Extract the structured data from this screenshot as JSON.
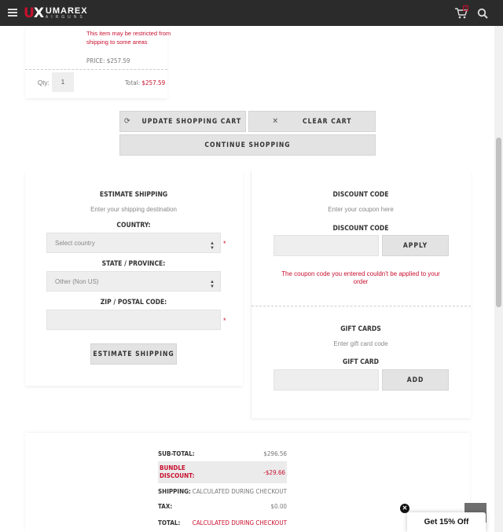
{
  "header": {
    "logo_mark": "UX",
    "logo_name": "UMAREX",
    "logo_sub": "AIRGUNS",
    "cart_count": "2"
  },
  "product": {
    "restriction_note": "This item may be restricted from shipping to some areas",
    "price": "PRICE: $257.59",
    "qty_label": "Qty:",
    "qty_value": "1",
    "total_label": "Total:",
    "total_value": "$257.59"
  },
  "cart_actions": {
    "update": "UPDATE SHOPPING CART",
    "clear": "CLEAR CART",
    "continue": "CONTINUE SHOPPING"
  },
  "estimate": {
    "title": "ESTIMATE SHIPPING",
    "subtitle": "Enter your shipping destination",
    "country_label": "COUNTRY:",
    "country_value": "Select country",
    "state_label": "STATE / PROVINCE:",
    "state_value": "Other (Non US)",
    "zip_label": "ZIP / POSTAL CODE:",
    "zip_value": "",
    "button": "ESTIMATE SHIPPING",
    "required_mark": "*"
  },
  "discount": {
    "title": "DISCOUNT CODE",
    "subtitle": "Enter your coupon here",
    "label": "DISCOUNT CODE",
    "value": "",
    "button": "APPLY",
    "error": "The coupon code you entered couldn't be applied to your order"
  },
  "gift": {
    "title": "GIFT CARDS",
    "subtitle": "Enter gift card code",
    "label": "GIFT CARD",
    "value": "",
    "button": "ADD"
  },
  "totals": {
    "subtotal_label": "SUB-TOTAL:",
    "subtotal_value": "$296.56",
    "bundle_label": "BUNDLE DISCOUNT:",
    "bundle_value": "-$29.66",
    "shipping_label": "SHIPPING:",
    "shipping_value": "CALCULATED DURING CHECKOUT",
    "tax_label": "TAX:",
    "tax_value": "$0.00",
    "total_label": "TOTAL:",
    "total_value": "CALCULATED DURING CHECKOUT"
  },
  "promo": {
    "label": "Get 15% Off",
    "close": "✕"
  },
  "colors": {
    "accent": "#c8102e",
    "header_bg": "#2b2b2b",
    "button_bg": "#e3e3e3"
  }
}
